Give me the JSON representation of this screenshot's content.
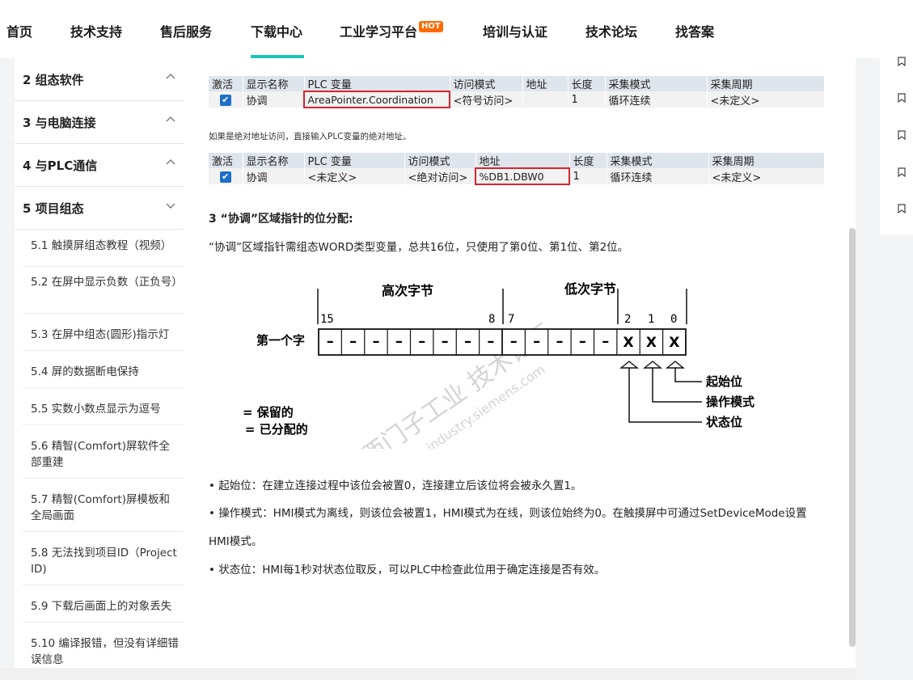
{
  "nav": {
    "items": [
      "首页",
      "技术支持",
      "售后服务",
      "下载中心",
      "工业学习平台",
      "培训与认证",
      "技术论坛",
      "找答案"
    ],
    "hot_badge": "HOT"
  },
  "sidebar": {
    "sections": [
      {
        "label": "2 组态软件"
      },
      {
        "label": "3 与电脑连接"
      },
      {
        "label": "4 与PLC通信"
      },
      {
        "label": "5 项目组态"
      }
    ],
    "subitems": [
      "5.1 触摸屏组态教程（视频）",
      "5.2 在屏中显示负数（正负号）",
      "5.3 在屏中组态(圆形)指示灯",
      "5.4 屏的数据断电保持",
      "5.5 实数小数点显示为逗号",
      "5.6 精智(Comfort)屏软件全部重建",
      "5.7 精智(Comfort)屏模板和全局画面",
      "5.8 无法找到项目ID（Project ID)",
      "5.9 下载后画面上的对象丢失",
      "5.10 编译报错，但没有详细错误信息"
    ]
  },
  "table1": {
    "headers": [
      "激活",
      "显示名称",
      "PLC 变量",
      "访问模式",
      "地址",
      "长度",
      "采集模式",
      "采集周期"
    ],
    "row": [
      "✔",
      "协调",
      "AreaPointer.Coordination",
      "<符号访问>",
      "",
      "1",
      "循环连续",
      "<未定义>"
    ]
  },
  "note_absolute": "如果是绝对地址访问，直接输入PLC变量的绝对地址。",
  "table2": {
    "headers": [
      "激活",
      "显示名称",
      "PLC 变量",
      "访问模式",
      "地址",
      "长度",
      "采集模式",
      "采集周期"
    ],
    "row": [
      "✔",
      "协调",
      "<未定义>",
      "<绝对访问>",
      "%DB1.DBW0",
      "1",
      "循环连续",
      "<未定义>"
    ]
  },
  "heading3": "3 “协调”区域指针的位分配:",
  "para_word": "“协调”区域指针需组态WORD类型变量，总共16位，只使用了第0位、第1位、第2位。",
  "diagram": {
    "high_byte": "高次字节",
    "low_byte": "低次字节",
    "bit15": "15",
    "bit8": "8",
    "bit7": "7",
    "bit2": "2",
    "bit1": "1",
    "bit0": "0",
    "first_word": "第一个字",
    "reserved_cell": "–",
    "assigned_cell": "X",
    "legend_reserved": "= 保留的",
    "legend_assigned": "x = 已分配的",
    "start_bit": "起始位",
    "op_mode": "操作模式",
    "status_bit": "状态位",
    "watermark1": "西门子工业 技术论坛",
    "watermark2": "support.industry.siemens.com"
  },
  "bullets": [
    "• 起始位：在建立连接过程中该位会被置0，连接建立后该位将会被永久置1。",
    "• 操作模式：HMI模式为离线，则该位会被置1，HMI模式为在线，则该位始终为0。在触摸屏中可通过SetDeviceMode设置",
    "HMI模式。",
    "• 状态位：HMI每1秒对状态位取反，可以PLC中检查此位用于确定连接是否有效。"
  ]
}
